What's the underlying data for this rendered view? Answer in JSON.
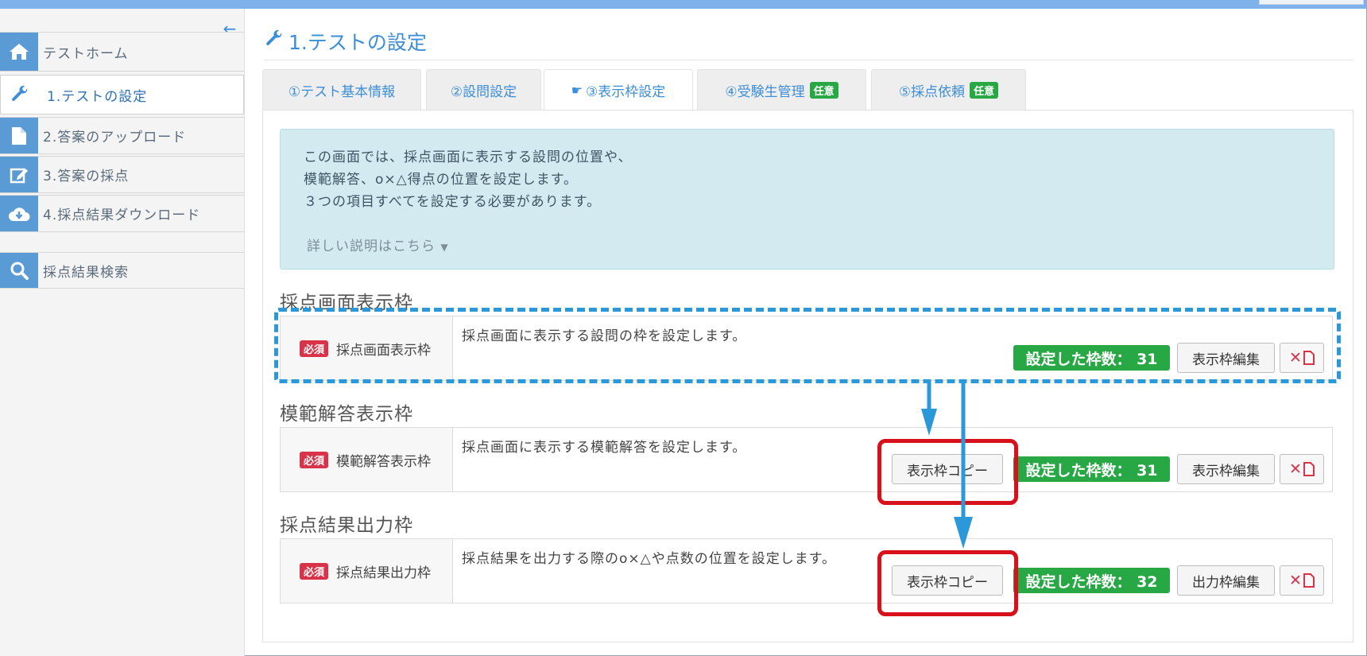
{
  "sidebar": {
    "items": [
      {
        "label": "テストホーム",
        "icon": "home-icon"
      },
      {
        "label": "1.テストの設定",
        "icon": "wrench-icon"
      },
      {
        "label": "2.答案のアップロード",
        "icon": "file-icon"
      },
      {
        "label": "3.答案の採点",
        "icon": "edit-icon"
      },
      {
        "label": "4.採点結果ダウンロード",
        "icon": "cloud-download-icon"
      },
      {
        "label": "採点結果検索",
        "icon": "search-icon"
      }
    ]
  },
  "page": {
    "title": "1.テストの設定"
  },
  "tabs": [
    {
      "label": "①テスト基本情報"
    },
    {
      "label": "②設問設定"
    },
    {
      "label": "③表示枠設定"
    },
    {
      "label": "④受験生管理",
      "badge": "任意"
    },
    {
      "label": "⑤採点依頼",
      "badge": "任意"
    }
  ],
  "info": {
    "line1": "この画面では、採点画面に表示する設問の位置や、",
    "line2": "模範解答、o×△得点の位置を設定します。",
    "line3": "３つの項目すべてを設定する必要があります。",
    "more": "詳しい説明はこちら"
  },
  "sections": [
    {
      "title": "採点画面表示枠",
      "required": "必須",
      "name": "採点画面表示枠",
      "desc": "採点画面に表示する設問の枠を設定します。",
      "count": "設定した枠数： 31",
      "edit": "表示枠編集"
    },
    {
      "title": "模範解答表示枠",
      "required": "必須",
      "name": "模範解答表示枠",
      "desc": "採点画面に表示する模範解答を設定します。",
      "copy": "表示枠コピー",
      "count": "設定した枠数： 31",
      "edit": "表示枠編集"
    },
    {
      "title": "採点結果出力枠",
      "required": "必須",
      "name": "採点結果出力枠",
      "desc": "採点結果を出力する際のo×△や点数の位置を設定します。",
      "copy": "表示枠コピー",
      "count": "設定した枠数： 32",
      "edit": "出力枠編集"
    }
  ],
  "colors": {
    "accent": "#3d8ed8",
    "success": "#28a745",
    "danger": "#d9334a",
    "annotation_blue": "#2b98d9",
    "annotation_red": "#d7101b"
  }
}
